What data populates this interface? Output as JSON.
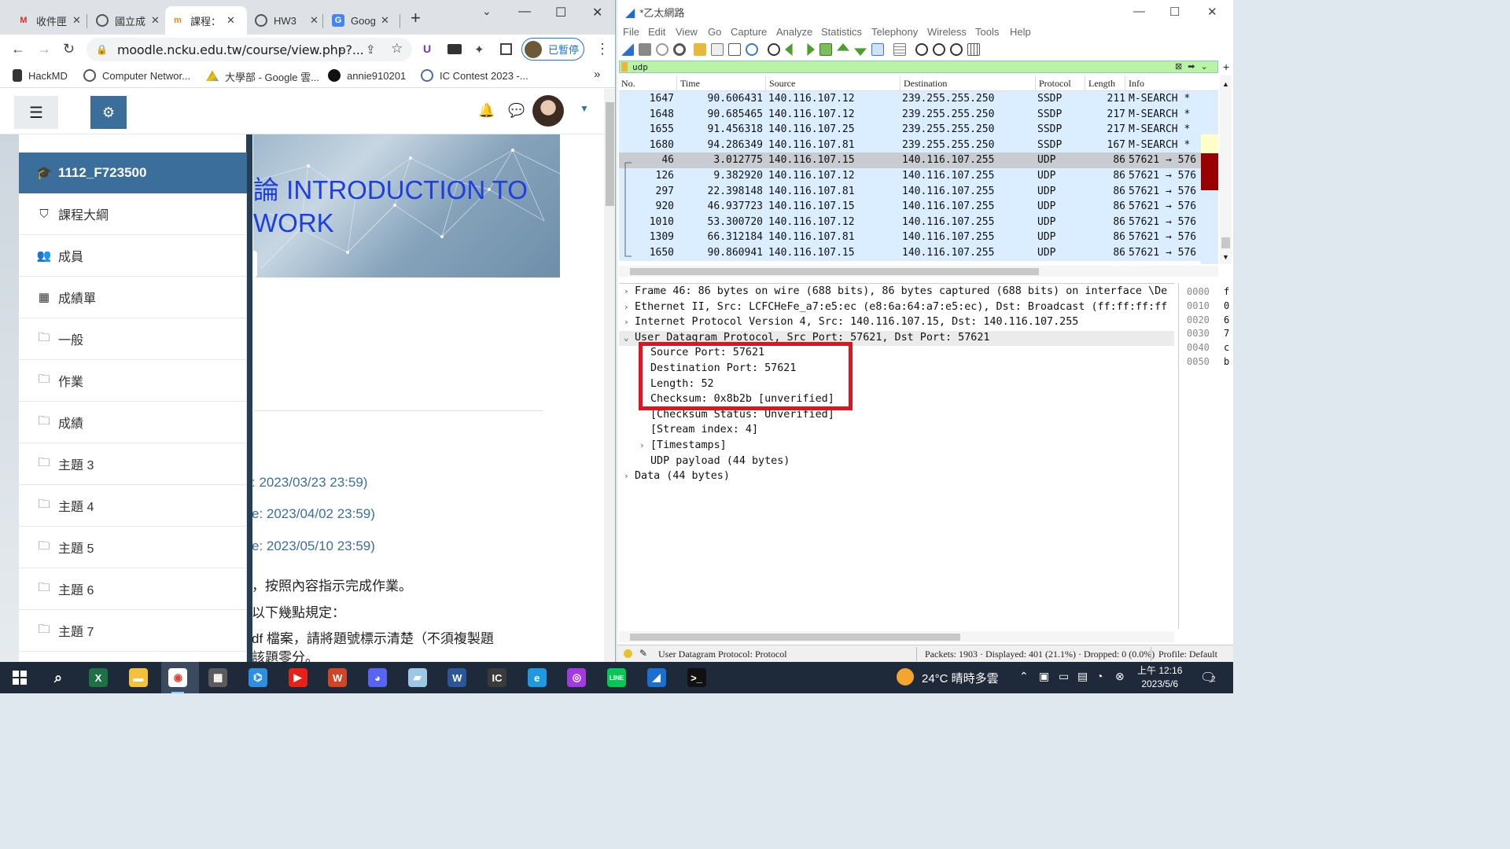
{
  "chrome": {
    "tabs": [
      {
        "label": "收件匣",
        "icon": "gmail-icon"
      },
      {
        "label": "國立成",
        "icon": "globe-icon"
      },
      {
        "label": "課程：",
        "icon": "moodle-icon"
      },
      {
        "label": "HW3",
        "icon": "globe-icon"
      },
      {
        "label": "Goog",
        "icon": "google-translate-icon"
      }
    ],
    "url": "moodle.ncku.edu.tw/course/view.php?...",
    "profile_label": "已暫停",
    "bookmarks": [
      "HackMD",
      "Computer Networ...",
      "大學部 - Google 雲...",
      "annie910201",
      "IC Contest 2023 -..."
    ],
    "bookmarks_more": "»"
  },
  "moodle": {
    "course_code": "1112_F723500",
    "nav": [
      "課程大綱",
      "成員",
      "成績單",
      "一般",
      "作業",
      "成績",
      "主題 3",
      "主題 4",
      "主題 5",
      "主題 6",
      "主題 7"
    ],
    "banner_title": "論 INTRODUCTION TO\nWORK",
    "due_dates": [
      ": 2023/03/23 23:59)",
      "e: 2023/04/02 23:59)",
      "e: 2023/05/10 23:59)"
    ],
    "content_lines": [
      "，按照內容指示完成作業。",
      "以下幾點規定：",
      "df 檔案，請將題號標示清楚（不須複製題",
      "該題零分。"
    ]
  },
  "wireshark": {
    "title": "*乙太網路",
    "menu": [
      "File",
      "Edit",
      "View",
      "Go",
      "Capture",
      "Analyze",
      "Statistics",
      "Telephony",
      "Wireless",
      "Tools",
      "Help"
    ],
    "filter": "udp",
    "columns": [
      "No.",
      "Time",
      "Source",
      "Destination",
      "Protocol",
      "Length",
      "Info"
    ],
    "packets": [
      {
        "no": "1647",
        "time": "90.606431",
        "src": "140.116.107.12",
        "dst": "239.255.255.250",
        "proto": "SSDP",
        "len": "211",
        "info": "M-SEARCH *"
      },
      {
        "no": "1648",
        "time": "90.685465",
        "src": "140.116.107.12",
        "dst": "239.255.255.250",
        "proto": "SSDP",
        "len": "217",
        "info": "M-SEARCH *"
      },
      {
        "no": "1655",
        "time": "91.456318",
        "src": "140.116.107.25",
        "dst": "239.255.255.250",
        "proto": "SSDP",
        "len": "217",
        "info": "M-SEARCH *"
      },
      {
        "no": "1680",
        "time": "94.286349",
        "src": "140.116.107.81",
        "dst": "239.255.255.250",
        "proto": "SSDP",
        "len": "167",
        "info": "M-SEARCH *"
      },
      {
        "no": "46",
        "time": "3.012775",
        "src": "140.116.107.15",
        "dst": "140.116.107.255",
        "proto": "UDP",
        "len": "86",
        "info": "57621 → 576"
      },
      {
        "no": "126",
        "time": "9.382920",
        "src": "140.116.107.12",
        "dst": "140.116.107.255",
        "proto": "UDP",
        "len": "86",
        "info": "57621 → 576"
      },
      {
        "no": "297",
        "time": "22.398148",
        "src": "140.116.107.81",
        "dst": "140.116.107.255",
        "proto": "UDP",
        "len": "86",
        "info": "57621 → 576"
      },
      {
        "no": "920",
        "time": "46.937723",
        "src": "140.116.107.15",
        "dst": "140.116.107.255",
        "proto": "UDP",
        "len": "86",
        "info": "57621 → 576"
      },
      {
        "no": "1010",
        "time": "53.300720",
        "src": "140.116.107.12",
        "dst": "140.116.107.255",
        "proto": "UDP",
        "len": "86",
        "info": "57621 → 576"
      },
      {
        "no": "1309",
        "time": "66.312184",
        "src": "140.116.107.81",
        "dst": "140.116.107.255",
        "proto": "UDP",
        "len": "86",
        "info": "57621 → 576"
      },
      {
        "no": "1650",
        "time": "90.860941",
        "src": "140.116.107.15",
        "dst": "140.116.107.255",
        "proto": "UDP",
        "len": "86",
        "info": "57621 → 576"
      }
    ],
    "selected_packet": "46",
    "details": [
      {
        "text": "Frame 46: 86 bytes on wire (688 bits), 86 bytes captured (688 bits) on interface \\De",
        "arrow": "›"
      },
      {
        "text": "Ethernet II, Src: LCFCHeFe_a7:e5:ec (e8:6a:64:a7:e5:ec), Dst: Broadcast (ff:ff:ff:ff",
        "arrow": "›"
      },
      {
        "text": "Internet Protocol Version 4, Src: 140.116.107.15, Dst: 140.116.107.255",
        "arrow": "›"
      },
      {
        "text": "User Datagram Protocol, Src Port: 57621, Dst Port: 57621",
        "arrow": "⌄"
      },
      {
        "text": "Source Port: 57621",
        "arrow": ""
      },
      {
        "text": "Destination Port: 57621",
        "arrow": ""
      },
      {
        "text": "Length: 52",
        "arrow": ""
      },
      {
        "text": "Checksum: 0x8b2b [unverified]",
        "arrow": ""
      },
      {
        "text": "[Checksum Status: Unverified]",
        "arrow": ""
      },
      {
        "text": "[Stream index: 4]",
        "arrow": ""
      },
      {
        "text": "[Timestamps]",
        "arrow": "›"
      },
      {
        "text": "UDP payload (44 bytes)",
        "arrow": ""
      },
      {
        "text": "Data (44 bytes)",
        "arrow": "›"
      }
    ],
    "hex": [
      {
        "off": "0000",
        "b": "f"
      },
      {
        "off": "0010",
        "b": "0"
      },
      {
        "off": "0020",
        "b": "6"
      },
      {
        "off": "0030",
        "b": "7"
      },
      {
        "off": "0040",
        "b": "c"
      },
      {
        "off": "0050",
        "b": "b"
      }
    ],
    "status": {
      "field": "User Datagram Protocol: Protocol",
      "counts": "Packets: 1903 · Displayed: 401 (21.1%) · Dropped: 0 (0.0%)",
      "profile": "Profile: Default"
    }
  },
  "taskbar": {
    "weather": "24°C  晴時多雲",
    "time": "上午 12:16",
    "date": "2023/5/6",
    "notif_count": "2",
    "apps": [
      "excel-icon",
      "file-explorer-icon",
      "chrome-icon",
      "calculator-icon",
      "vscode-icon",
      "youtube-music-icon",
      "wps-icon",
      "discord-icon",
      "paper-icon",
      "word-icon",
      "ic-contest-icon",
      "edge-icon",
      "messenger-icon",
      "line-icon",
      "wireshark-icon",
      "terminal-icon"
    ]
  }
}
